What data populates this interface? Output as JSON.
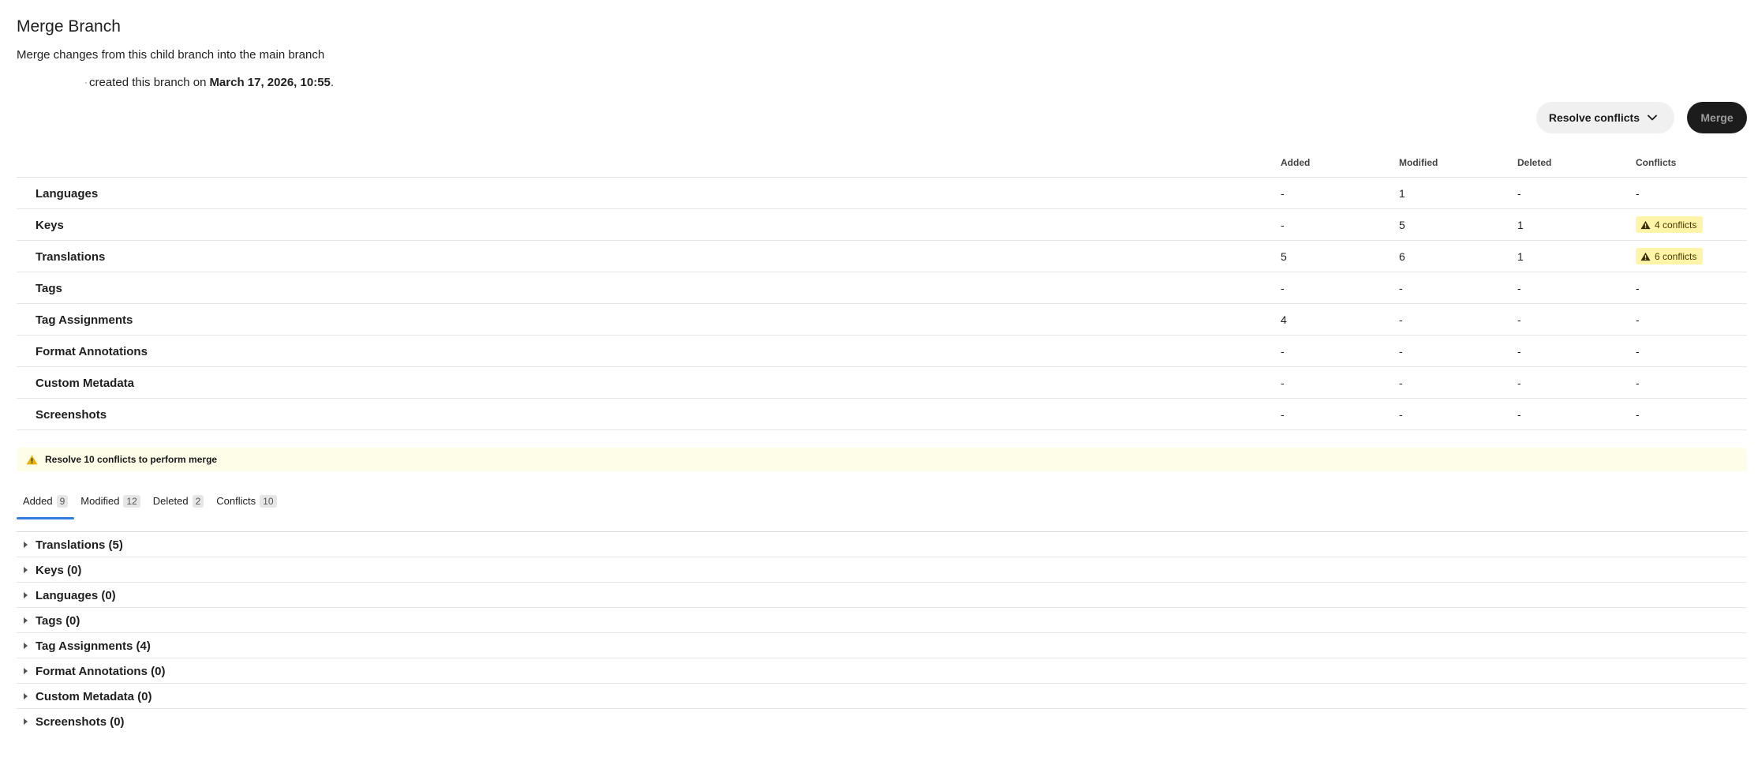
{
  "header": {
    "title": "Merge Branch",
    "subtitle": "Merge changes from this child branch into the main branch",
    "created_text": "created this branch on",
    "created_date": "March 17, 2026, 10:55",
    "created_suffix": "."
  },
  "actions": {
    "resolve_label": "Resolve conflicts",
    "merge_label": "Merge"
  },
  "summary": {
    "columns": [
      "Added",
      "Modified",
      "Deleted",
      "Conflicts"
    ],
    "rows": [
      {
        "name": "Languages",
        "added": "-",
        "modified": "1",
        "deleted": "-",
        "conflicts": "-"
      },
      {
        "name": "Keys",
        "added": "-",
        "modified": "5",
        "deleted": "1",
        "conflicts": "4 conflicts"
      },
      {
        "name": "Translations",
        "added": "5",
        "modified": "6",
        "deleted": "1",
        "conflicts": "6 conflicts"
      },
      {
        "name": "Tags",
        "added": "-",
        "modified": "-",
        "deleted": "-",
        "conflicts": "-"
      },
      {
        "name": "Tag Assignments",
        "added": "4",
        "modified": "-",
        "deleted": "-",
        "conflicts": "-"
      },
      {
        "name": "Format Annotations",
        "added": "-",
        "modified": "-",
        "deleted": "-",
        "conflicts": "-"
      },
      {
        "name": "Custom Metadata",
        "added": "-",
        "modified": "-",
        "deleted": "-",
        "conflicts": "-"
      },
      {
        "name": "Screenshots",
        "added": "-",
        "modified": "-",
        "deleted": "-",
        "conflicts": "-"
      }
    ]
  },
  "alert": {
    "text": "Resolve 10 conflicts to perform merge",
    "color": "#fefde8"
  },
  "tabs": [
    {
      "label": "Added",
      "count": "9",
      "active": true
    },
    {
      "label": "Modified",
      "count": "12",
      "active": false
    },
    {
      "label": "Deleted",
      "count": "2",
      "active": false
    },
    {
      "label": "Conflicts",
      "count": "10",
      "active": false
    }
  ],
  "groups": [
    "Translations (5)",
    "Keys (0)",
    "Languages (0)",
    "Tags (0)",
    "Tag Assignments (4)",
    "Format Annotations (0)",
    "Custom Metadata (0)",
    "Screenshots (0)"
  ],
  "colors": {
    "accent": "#2f7de1",
    "conflict_badge": "#fff4a8",
    "merge_button": "#1c1c1c"
  },
  "icons": {
    "dropdown": "chevron-down-icon",
    "warning": "warning-triangle-icon",
    "expand": "caret-right-icon"
  }
}
